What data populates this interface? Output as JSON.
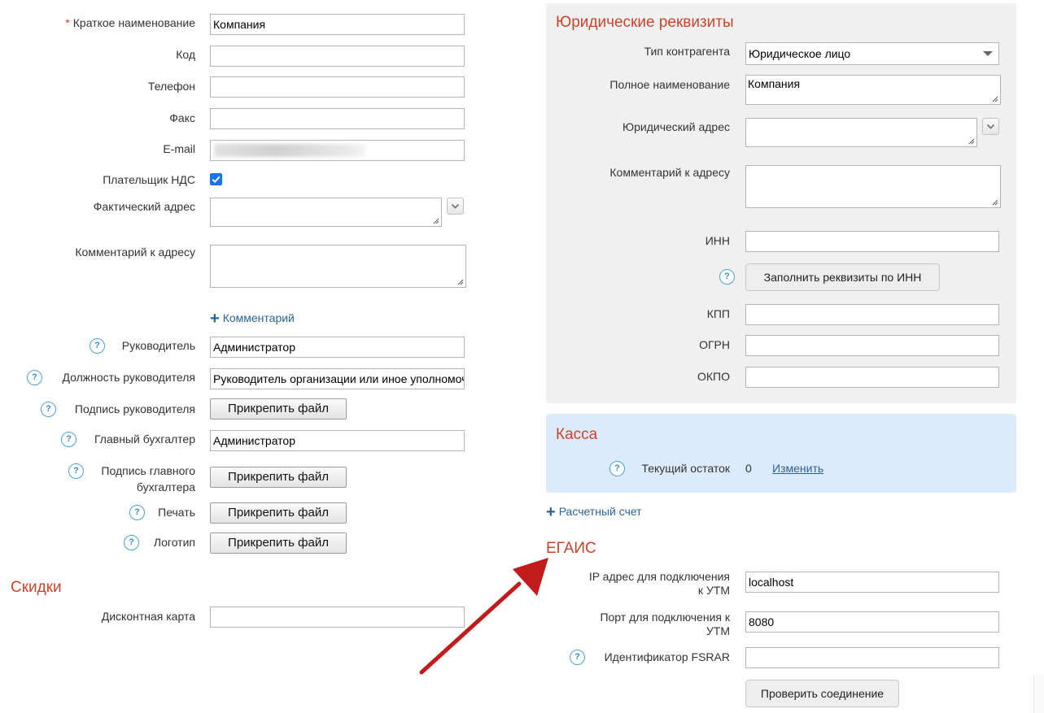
{
  "left": {
    "short_name": {
      "label": "Краткое наименование",
      "required_mark": "*",
      "value": "Компания"
    },
    "code": {
      "label": "Код",
      "value": ""
    },
    "phone": {
      "label": "Телефон",
      "value": ""
    },
    "fax": {
      "label": "Факс",
      "value": ""
    },
    "email": {
      "label": "E-mail",
      "value": ""
    },
    "vat_payer": {
      "label": "Плательщик НДС",
      "checked": true
    },
    "actual_address": {
      "label": "Фактический адрес",
      "value": ""
    },
    "address_comment": {
      "label": "Комментарий к адресу",
      "value": ""
    },
    "add_comment_link": "Комментарий",
    "director": {
      "label": "Руководитель",
      "value": "Администратор"
    },
    "director_position": {
      "label": "Должность руководителя",
      "value": "Руководитель организации или иное уполномоченное лицо"
    },
    "director_signature": {
      "label": "Подпись руководителя",
      "button": "Прикрепить файл"
    },
    "chief_accountant": {
      "label": "Главный бухгалтер",
      "value": "Администратор"
    },
    "accountant_signature": {
      "label_line1": "Подпись главного",
      "label_line2": "бухгалтера",
      "button": "Прикрепить файл"
    },
    "stamp": {
      "label": "Печать",
      "button": "Прикрепить файл"
    },
    "logo": {
      "label": "Логотип",
      "button": "Прикрепить файл"
    }
  },
  "discounts": {
    "title": "Скидки",
    "discount_card": {
      "label": "Дисконтная карта",
      "value": ""
    }
  },
  "legal": {
    "title": "Юридические реквизиты",
    "counterparty_type": {
      "label": "Тип контрагента",
      "value": "Юридическое лицо"
    },
    "full_name": {
      "label": "Полное наименование",
      "value": "Компания"
    },
    "legal_address": {
      "label": "Юридический адрес",
      "value": ""
    },
    "address_comment": {
      "label": "Комментарий к адресу",
      "value": ""
    },
    "inn": {
      "label": "ИНН",
      "value": ""
    },
    "fill_by_inn_button": "Заполнить реквизиты по ИНН",
    "kpp": {
      "label": "КПП",
      "value": ""
    },
    "ogrn": {
      "label": "ОГРН",
      "value": ""
    },
    "okpo": {
      "label": "ОКПО",
      "value": ""
    }
  },
  "cash": {
    "title": "Касса",
    "balance_label": "Текущий остаток",
    "balance_value": "0",
    "change_link": "Изменить"
  },
  "bank_account_link": "Расчетный счет",
  "egais": {
    "title": "ЕГАИС",
    "ip": {
      "label_line1": "IP адрес для подключения",
      "label_line2": "к УТМ",
      "value": "localhost"
    },
    "port": {
      "label_line1": "Порт для подключения к",
      "label_line2": "УТМ",
      "value": "8080"
    },
    "fsrar": {
      "label": "Идентификатор FSRAR",
      "value": ""
    },
    "check_button": "Проверить соединение"
  },
  "help_symbol": "?",
  "colors": {
    "section_title": "#c8452b",
    "link": "#2a6496",
    "annotation_arrow": "#c21b1b",
    "cash_panel": "#dcebfb",
    "legal_panel": "#f0f0f0"
  }
}
